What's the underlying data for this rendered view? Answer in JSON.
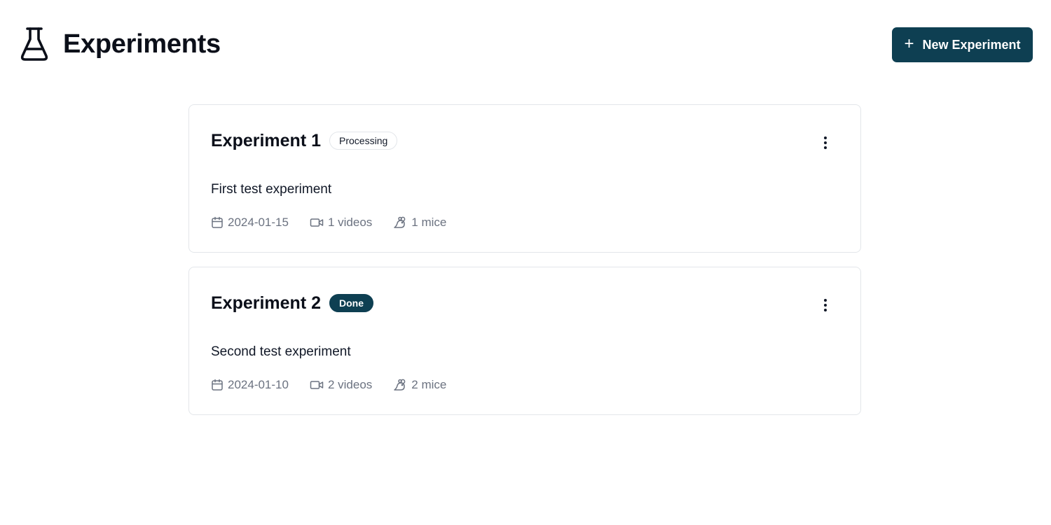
{
  "header": {
    "title": "Experiments",
    "icon": "flask-icon",
    "new_button_label": "New Experiment"
  },
  "colors": {
    "primary": "#0e3f52",
    "border": "#e3e6ea",
    "muted_text": "#6b7280"
  },
  "experiments": [
    {
      "title": "Experiment 1",
      "status": "Processing",
      "description": "First test experiment",
      "date": "2024-01-15",
      "videos": "1 videos",
      "mice": "1 mice"
    },
    {
      "title": "Experiment 2",
      "status": "Done",
      "description": "Second test experiment",
      "date": "2024-01-10",
      "videos": "2 videos",
      "mice": "2 mice"
    }
  ]
}
